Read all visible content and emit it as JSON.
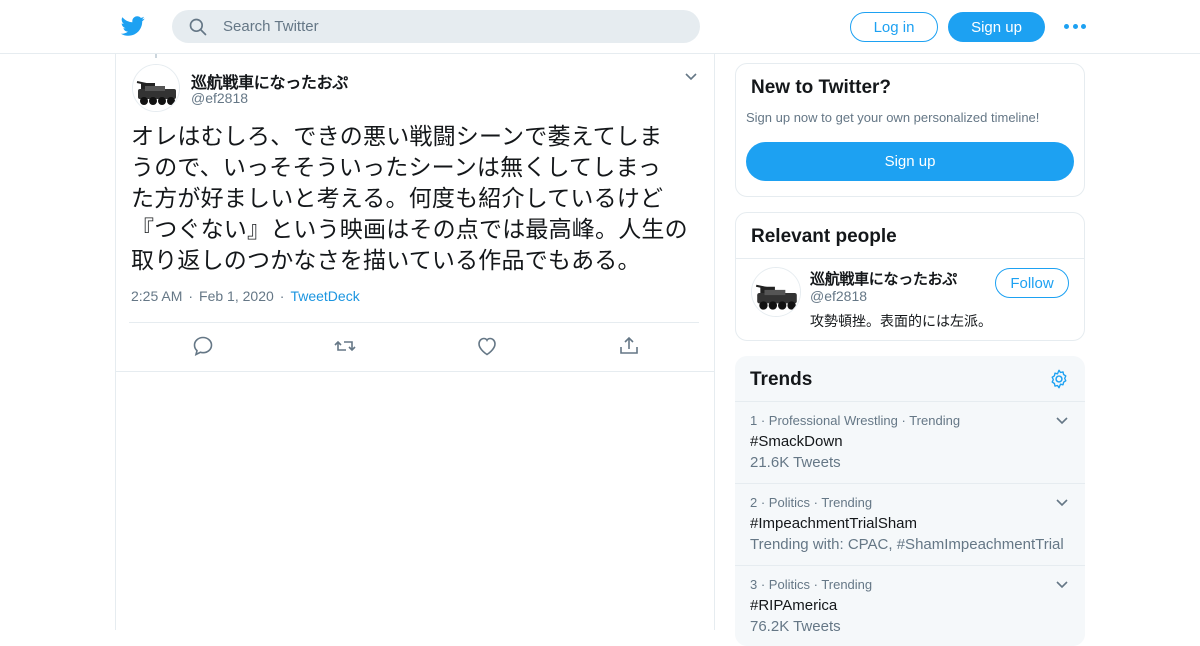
{
  "header": {
    "search_placeholder": "Search Twitter",
    "login_label": "Log in",
    "signup_label": "Sign up",
    "brand_color": "#1da1f2"
  },
  "tweet": {
    "author_name": "巡航戦車になったおぷ",
    "author_handle": "@ef2818",
    "lines": [
      "オレはむしろ、できの悪い戦闘シーンで萎えてしま",
      "うので、いっそそういったシーンは無くしてしまっ",
      "た方が好ましいと考える。何度も紹介しているけど",
      "『つぐない』という映画はその点では最高峰。人生の",
      "取り返しのつかなさを描いている作品でもある。"
    ],
    "time": "2:25 AM",
    "date": "Feb 1, 2020",
    "source": "TweetDeck",
    "actions": [
      "reply-icon",
      "retweet-icon",
      "like-icon",
      "share-icon"
    ]
  },
  "sidebar": {
    "new_to_twitter": {
      "title": "New to Twitter?",
      "subtitle": "Sign up now to get your own personalized timeline!",
      "button": "Sign up"
    },
    "relevant_people": {
      "title": "Relevant people",
      "person": {
        "name": "巡航戦車になったおぷ",
        "handle": "@ef2818",
        "bio": "攻勢頓挫。表面的には左派。",
        "follow_label": "Follow"
      }
    },
    "trends": {
      "title": "Trends",
      "items": [
        {
          "rank": "1",
          "category": "Professional Wrestling",
          "status": "Trending",
          "name": "#SmackDown",
          "detail": "21.6K Tweets"
        },
        {
          "rank": "2",
          "category": "Politics",
          "status": "Trending",
          "name": "#ImpeachmentTrialSham",
          "detail": "Trending with: CPAC, #ShamImpeachmentTrial"
        },
        {
          "rank": "3",
          "category": "Politics",
          "status": "Trending",
          "name": "#RIPAmerica",
          "detail": "76.2K Tweets"
        }
      ]
    }
  }
}
